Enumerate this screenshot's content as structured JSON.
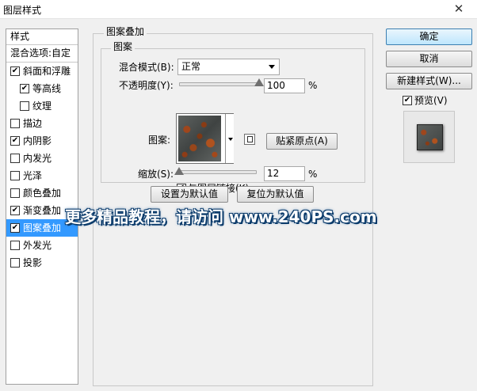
{
  "window": {
    "title": "图层样式",
    "close_glyph": "✕"
  },
  "style_list": {
    "header": "样式",
    "blend_options": "混合选项:自定",
    "items": [
      {
        "label": "斜面和浮雕",
        "checked": true,
        "sub": false,
        "active": false
      },
      {
        "label": "等高线",
        "checked": true,
        "sub": true,
        "active": false
      },
      {
        "label": "纹理",
        "checked": false,
        "sub": true,
        "active": false
      },
      {
        "label": "描边",
        "checked": false,
        "sub": false,
        "active": false
      },
      {
        "label": "内阴影",
        "checked": true,
        "sub": false,
        "active": false
      },
      {
        "label": "内发光",
        "checked": false,
        "sub": false,
        "active": false
      },
      {
        "label": "光泽",
        "checked": false,
        "sub": false,
        "active": false
      },
      {
        "label": "颜色叠加",
        "checked": false,
        "sub": false,
        "active": false
      },
      {
        "label": "渐变叠加",
        "checked": true,
        "sub": false,
        "active": false
      },
      {
        "label": "图案叠加",
        "checked": true,
        "sub": false,
        "active": true
      },
      {
        "label": "外发光",
        "checked": false,
        "sub": false,
        "active": false
      },
      {
        "label": "投影",
        "checked": false,
        "sub": false,
        "active": false
      }
    ]
  },
  "panel": {
    "title": "图案叠加",
    "subgroup": "图案",
    "blend_mode_label": "混合模式(B):",
    "blend_mode_value": "正常",
    "opacity_label": "不透明度(Y):",
    "opacity_value": "100",
    "opacity_fraction": 1.0,
    "percent": "%",
    "pattern_label": "图案:",
    "snap_origin": "贴紧原点(A)",
    "scale_label": "缩放(S):",
    "scale_value": "12",
    "scale_fraction": 0.0,
    "link_layer": "与图层链接(K)",
    "link_checked": true,
    "make_default": "设置为默认值",
    "reset_default": "复位为默认值"
  },
  "actions": {
    "ok": "确定",
    "cancel": "取消",
    "new_style": "新建样式(W)...",
    "preview_label": "预览(V)",
    "preview_checked": true
  },
  "watermark": "更多精品教程，请访问 www.240PS.com",
  "check_glyph": "✔"
}
